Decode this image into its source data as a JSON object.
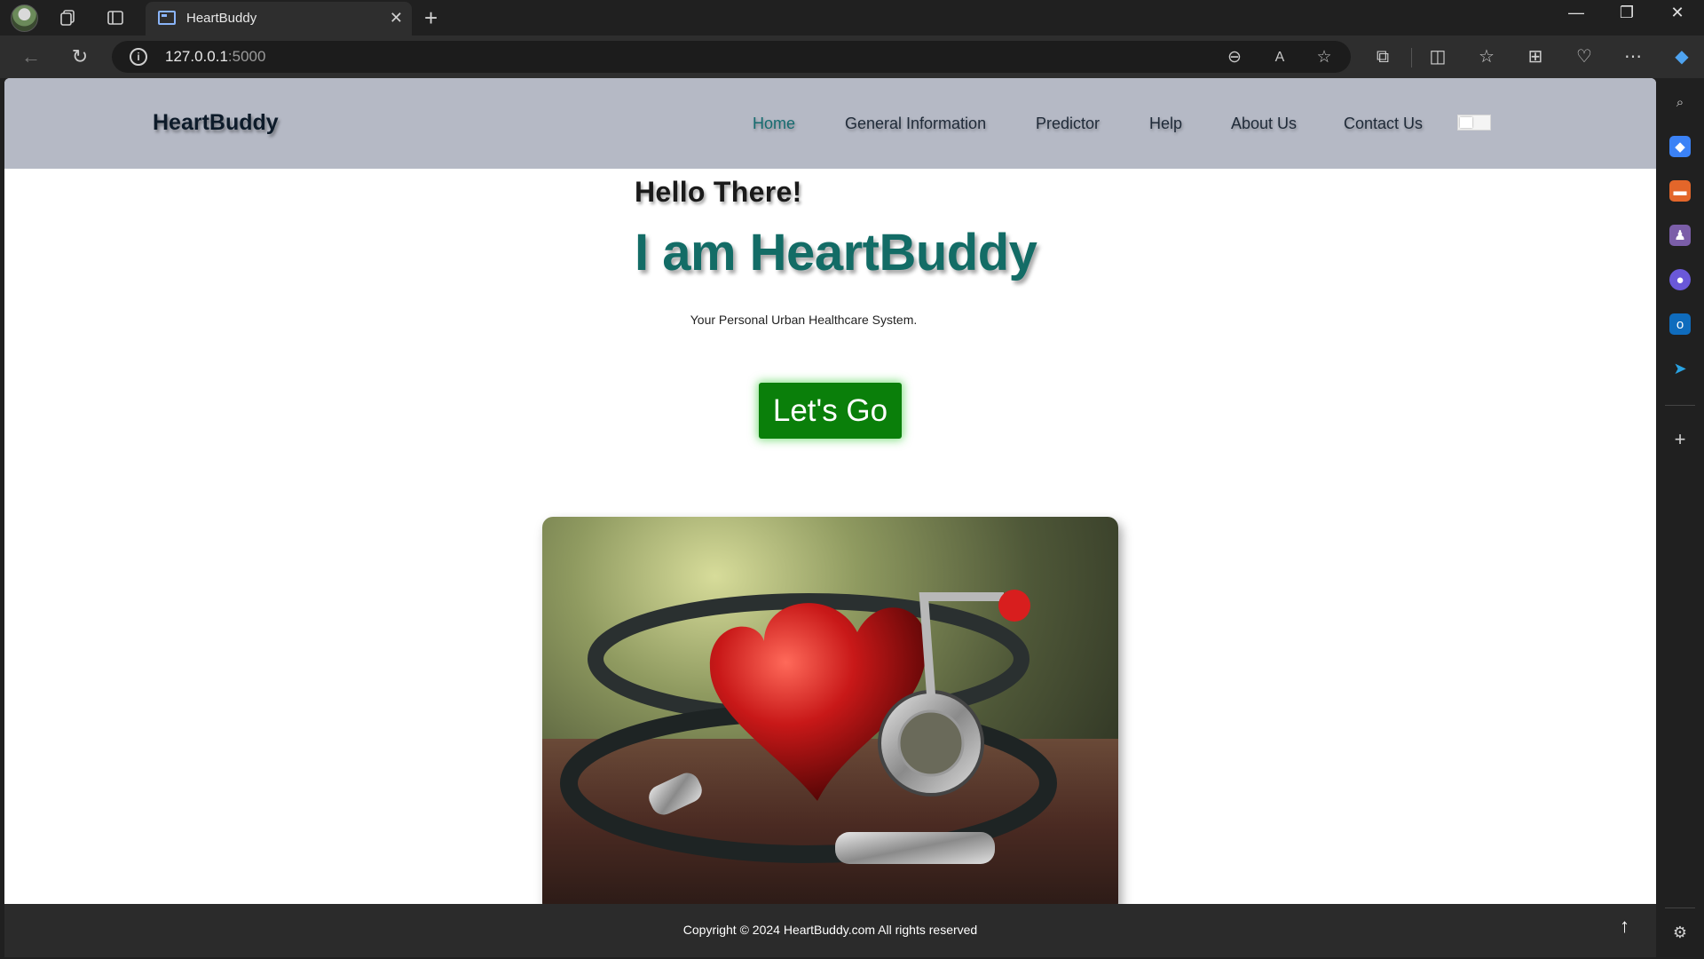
{
  "browser": {
    "tab_title": "HeartBuddy",
    "url_host": "127.0.0.1",
    "url_port": ":5000"
  },
  "site": {
    "brand": "HeartBuddy",
    "nav": [
      {
        "label": "Home",
        "active": true
      },
      {
        "label": "General Information",
        "active": false
      },
      {
        "label": "Predictor",
        "active": false
      },
      {
        "label": "Help",
        "active": false
      },
      {
        "label": "About Us",
        "active": false
      },
      {
        "label": "Contact Us",
        "active": false
      }
    ],
    "theme_toggle_on": false
  },
  "hero": {
    "greeting": "Hello There!",
    "title": "I am HeartBuddy",
    "tagline": "Your Personal Urban Healthcare System.",
    "cta_label": "Let's Go"
  },
  "footer": {
    "copyright": "Copyright © 2024 HeartBuddy.com All rights reserved"
  },
  "colors": {
    "header_bg": "#b5b9c5",
    "accent": "#136c66",
    "cta": "#0a7f0a",
    "footer_bg": "#2b2b2b"
  }
}
